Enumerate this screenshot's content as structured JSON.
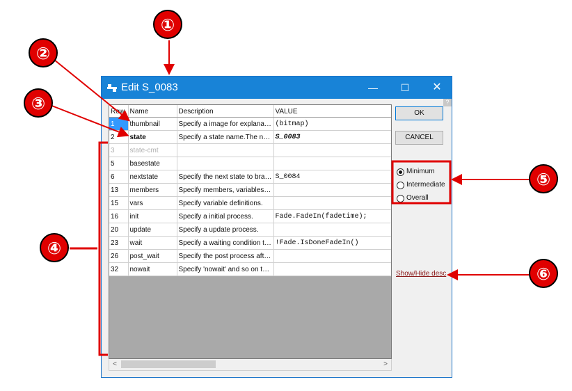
{
  "window": {
    "title": "Edit S_0083",
    "controls": {
      "minimize": "—",
      "maximize": "☐",
      "close": "✕"
    },
    "help": "?"
  },
  "grid": {
    "columns": [
      "Row",
      "Name",
      "Description",
      "VALUE"
    ],
    "rows": [
      {
        "row": "1",
        "name": "thumbnail",
        "description": "Specify a image for explanation.",
        "value": "(bitmap)"
      },
      {
        "row": "2",
        "name": "state",
        "description": "Specify a state name.The name must be unique.",
        "value": "S_0083"
      },
      {
        "row": "3",
        "name": "state-cmt",
        "description": "",
        "value": ""
      },
      {
        "row": "5",
        "name": "basestate",
        "description": "",
        "value": ""
      },
      {
        "row": "6",
        "name": "nextstate",
        "description": "Specify the next state to branch.",
        "value": "S_0084"
      },
      {
        "row": "13",
        "name": "members",
        "description": "Specify members, variables and functions.",
        "value": ""
      },
      {
        "row": "15",
        "name": "vars",
        "description": "Specify variable definitions.",
        "value": ""
      },
      {
        "row": "16",
        "name": "init",
        "description": "Specify a initial process.",
        "value": "Fade.FadeIn(fadetime);"
      },
      {
        "row": "20",
        "name": "update",
        "description": "Specify a update process.",
        "value": ""
      },
      {
        "row": "23",
        "name": "wait",
        "description": "Specify a waiting condition to go next.",
        "value": "!Fade.IsDoneFadeIn()"
      },
      {
        "row": "26",
        "name": "post_wait",
        "description": "Specify the post process after waiting.",
        "value": ""
      },
      {
        "row": "32",
        "name": "nowait",
        "description": "Specify 'nowait' and so on to skip waiting.",
        "value": ""
      }
    ]
  },
  "scrollbar": {
    "left_arrow": "<",
    "right_arrow": ">"
  },
  "buttons": {
    "ok": "OK",
    "cancel": "CANCEL"
  },
  "view_mode": {
    "options": [
      "Minimum",
      "Intermediate",
      "Overall"
    ],
    "selected": "Minimum"
  },
  "link": {
    "show_hide": "Show/Hide desc"
  },
  "annotations": {
    "markers": [
      "①",
      "②",
      "③",
      "④",
      "⑤",
      "⑥"
    ],
    "colors": {
      "marker_fill": "#e00000",
      "line": "#e00000",
      "marker_text": "#ffffff"
    }
  },
  "colors": {
    "titlebar": "#1883d7",
    "selection": "#3399ff",
    "link": "#8b1a1a",
    "grid_empty": "#a9a9a9"
  }
}
